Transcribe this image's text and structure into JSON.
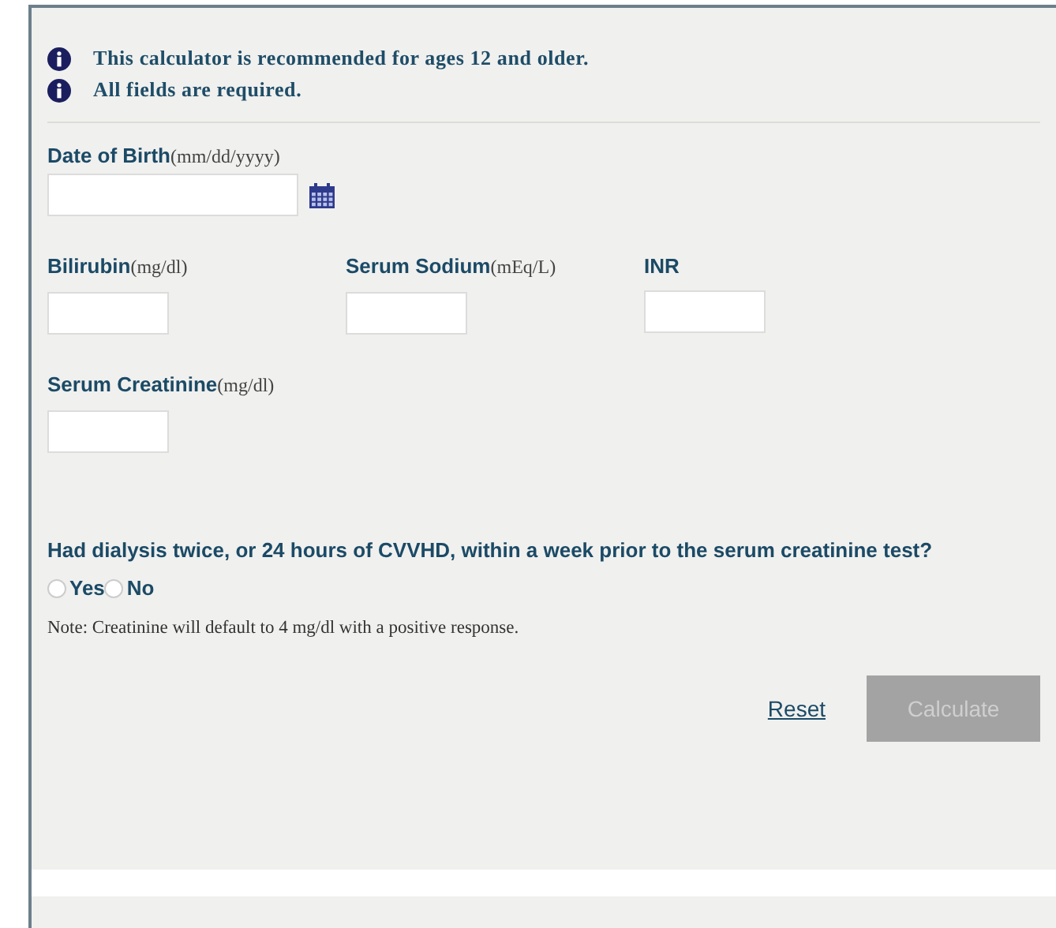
{
  "notices": [
    "This calculator is recommended for ages 12 and older.",
    "All fields are required."
  ],
  "date_field": {
    "label": "Date of Birth",
    "unit": "(mm/dd/yyyy)"
  },
  "lab_fields": [
    {
      "label": "Bilirubin",
      "unit": "(mg/dl)"
    },
    {
      "label": "Serum Sodium",
      "unit": "(mEq/L)"
    },
    {
      "label": "INR"
    }
  ],
  "creatinine_field": {
    "label": "Serum Creatinine",
    "unit": "(mg/dl)"
  },
  "dialysis": {
    "question": "Had dialysis twice, or 24 hours of CVVHD, within a week prior to the serum creatinine test?",
    "options": [
      {
        "label": "Yes",
        "selected": false
      },
      {
        "label": "No",
        "selected": false
      }
    ],
    "note": "Note: Creatinine will default to 4 mg/dl with a positive response."
  },
  "actions": {
    "reset": "Reset",
    "calculate": {
      "label": "Calculate",
      "disabled": true
    }
  }
}
